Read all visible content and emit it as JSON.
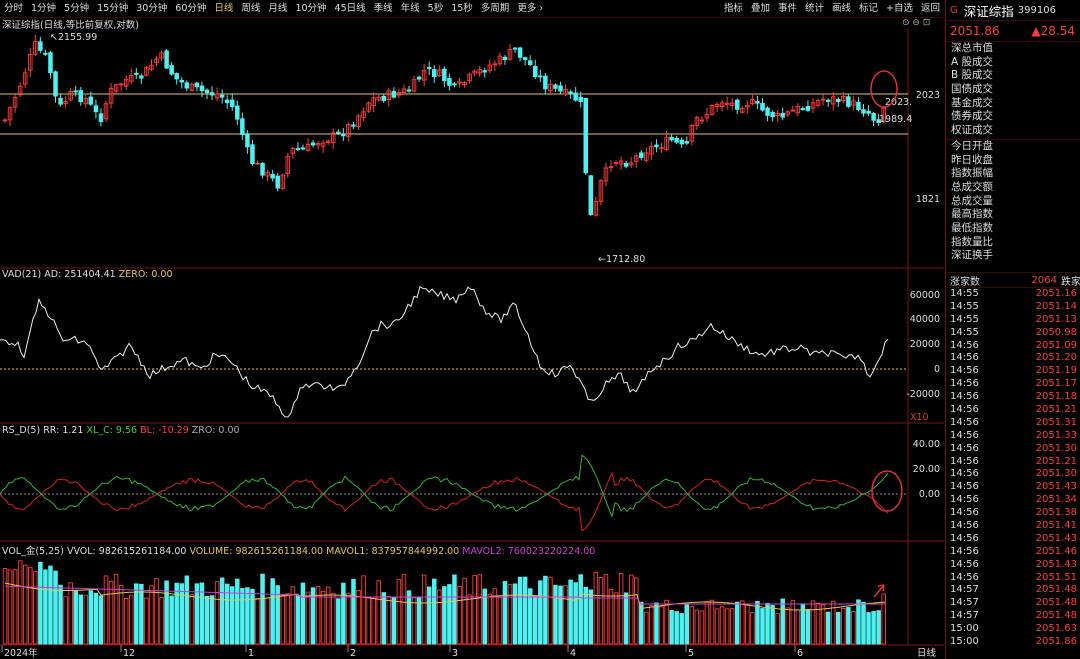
{
  "toolbar": {
    "periods": [
      "分时",
      "1分钟",
      "5分钟",
      "15分钟",
      "30分钟",
      "60分钟",
      "日线",
      "周线",
      "月线",
      "10分钟",
      "45日线",
      "季线",
      "年线",
      "5秒",
      "15秒",
      "多周期",
      "更多 ›"
    ],
    "active_period": "日线",
    "right_items": [
      "指标",
      "叠加",
      "事件",
      "统计",
      "画线",
      "标记",
      "+自选",
      "返回"
    ]
  },
  "chart_title": "深证综指(日线,等比前复权,对数)",
  "corner_icons": "⊙ ⊖ ⊡",
  "price_labels": {
    "high": "2155.99",
    "low": "1712.80",
    "level_2023": "2023",
    "level_1821": "1821",
    "tag_2023": "2023.",
    "tag_1989": "1989.4"
  },
  "vad_panel": {
    "name": "VAD(21)",
    "ad": "AD: 251404.41",
    "zero": "ZERO: 0.00",
    "axis": [
      "60000",
      "40000",
      "20000",
      "0",
      "-20000"
    ],
    "unit": "X10"
  },
  "rs_panel": {
    "name": "RS_D(5)",
    "rr": "RR: 1.21",
    "xlc": "XL_C: 9.56",
    "bl": "BL: -10.29",
    "zro": "ZRO: 0.00",
    "axis": [
      "40.00",
      "20.00",
      "0.00"
    ]
  },
  "vol_panel": {
    "name": "VOL_金(5,25)",
    "vvol": "VVOL: 982615261184.00",
    "volume": "VOLUME: 982615261184.00",
    "mavol1": "MAVOL1: 837957844992.00",
    "mavol2": "MAVOL2: 760023220224.00"
  },
  "x_axis": {
    "labels": [
      "2024年",
      "12",
      "1",
      "2",
      "3",
      "4",
      "5",
      "6"
    ],
    "period_tag": "日线"
  },
  "colors": {
    "up": "#ff3b3b",
    "down": "#4ef0f0",
    "yellow": "#e6c84a",
    "magenta": "#d23cd2",
    "green": "#3ad03a"
  },
  "quote": {
    "flag": "G",
    "name": "深证综指",
    "code": "399106",
    "price": "2051.86",
    "change": "▲28.54",
    "sections": [
      [
        "深总市值",
        "A 股成交",
        "B 股成交",
        "国债成交",
        "基金成交",
        "债券成交",
        "权证成交"
      ],
      [
        "今日开盘",
        "昨日收盘",
        "指数振幅",
        "总成交额",
        "总成交量",
        "最高指数",
        "最低指数",
        "指数量比",
        "深证换手"
      ]
    ],
    "ticks_header": {
      "left": "涨家数",
      "value": "2064",
      "right": "跌家"
    },
    "ticks": [
      [
        "14:55",
        "2051.16"
      ],
      [
        "14:55",
        "2051.14"
      ],
      [
        "14:55",
        "2051.13"
      ],
      [
        "14:55",
        "2050.98"
      ],
      [
        "14:56",
        "2051.09"
      ],
      [
        "14:56",
        "2051.20"
      ],
      [
        "14:56",
        "2051.19"
      ],
      [
        "14:56",
        "2051.17"
      ],
      [
        "14:56",
        "2051.18"
      ],
      [
        "14:56",
        "2051.21"
      ],
      [
        "14:56",
        "2051.31"
      ],
      [
        "14:56",
        "2051.33"
      ],
      [
        "14:56",
        "2051.30"
      ],
      [
        "14:56",
        "2051.21"
      ],
      [
        "14:56",
        "2051.30"
      ],
      [
        "14:56",
        "2051.43"
      ],
      [
        "14:56",
        "2051.34"
      ],
      [
        "14:56",
        "2051.38"
      ],
      [
        "14:56",
        "2051.41"
      ],
      [
        "14:56",
        "2051.43"
      ],
      [
        "14:56",
        "2051.46"
      ],
      [
        "14:56",
        "2051.43"
      ],
      [
        "14:56",
        "2051.51"
      ],
      [
        "14:57",
        "2051.48"
      ],
      [
        "14:57",
        "2051.48"
      ],
      [
        "14:57",
        "2051.48"
      ],
      [
        "15:00",
        "2051.63"
      ],
      [
        "15:00",
        "2051.86"
      ]
    ]
  }
}
